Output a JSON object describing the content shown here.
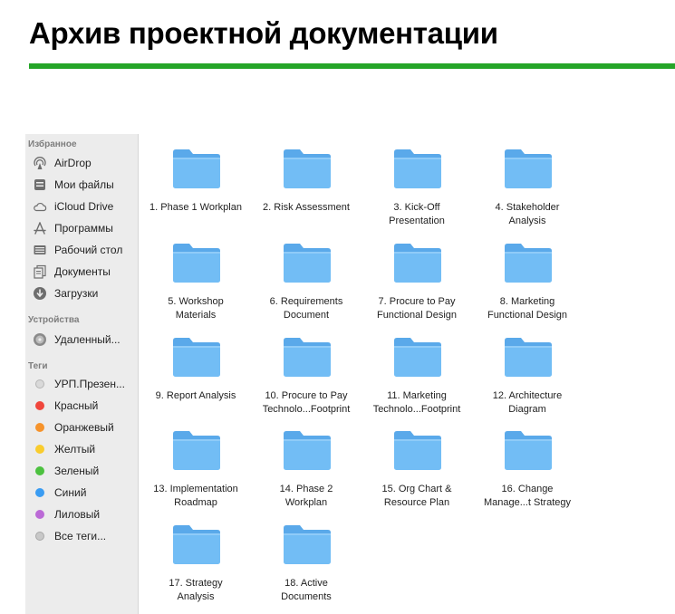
{
  "page_title": "Архив проектной документации",
  "colors": {
    "accent_rule": "#25a528",
    "folder": "#6fb9f3"
  },
  "sidebar": {
    "favorites_heading": "Избранное",
    "favorites": [
      {
        "label": "AirDrop",
        "icon": "airdrop-icon"
      },
      {
        "label": "Мои файлы",
        "icon": "my-files-icon"
      },
      {
        "label": "iCloud Drive",
        "icon": "cloud-icon"
      },
      {
        "label": "Программы",
        "icon": "applications-icon"
      },
      {
        "label": "Рабочий стол",
        "icon": "desktop-icon"
      },
      {
        "label": "Документы",
        "icon": "documents-icon"
      },
      {
        "label": "Загрузки",
        "icon": "downloads-icon"
      }
    ],
    "devices_heading": "Устройства",
    "devices": [
      {
        "label": "Удаленный...",
        "icon": "remote-disc-icon"
      }
    ],
    "tags_heading": "Теги",
    "tags": [
      {
        "label": "УРП.Презен...",
        "color": "#d9d9d9"
      },
      {
        "label": "Красный",
        "color": "#f0463c"
      },
      {
        "label": "Оранжевый",
        "color": "#f6932b"
      },
      {
        "label": "Желтый",
        "color": "#f9cc2d"
      },
      {
        "label": "Зеленый",
        "color": "#4cc13f"
      },
      {
        "label": "Синий",
        "color": "#3a9cf2"
      },
      {
        "label": "Лиловый",
        "color": "#bb6ad6"
      },
      {
        "label": "Все теги...",
        "color": "#c8c8c8"
      }
    ]
  },
  "folders": [
    {
      "line1": "1. Phase 1 Workplan",
      "line2": ""
    },
    {
      "line1": "2. Risk Assessment",
      "line2": ""
    },
    {
      "line1": "3. Kick-Off",
      "line2": "Presentation"
    },
    {
      "line1": "4. Stakeholder",
      "line2": "Analysis"
    },
    {
      "line1": "5. Workshop",
      "line2": "Materials"
    },
    {
      "line1": "6. Requirements",
      "line2": "Document"
    },
    {
      "line1": "7. Procure to Pay",
      "line2": "Functional Design"
    },
    {
      "line1": "8. Marketing",
      "line2": "Functional Design"
    },
    {
      "line1": "9. Report Analysis",
      "line2": ""
    },
    {
      "line1": "10. Procure to Pay",
      "line2": "Technolo...Footprint"
    },
    {
      "line1": "11. Marketing",
      "line2": "Technolo...Footprint"
    },
    {
      "line1": "12. Architecture",
      "line2": "Diagram"
    },
    {
      "line1": "13. Implementation",
      "line2": "Roadmap"
    },
    {
      "line1": "14. Phase 2",
      "line2": "Workplan"
    },
    {
      "line1": "15. Org Chart &",
      "line2": "Resource Plan"
    },
    {
      "line1": "16. Change",
      "line2": "Manage...t Strategy"
    },
    {
      "line1": "17. Strategy",
      "line2": "Analysis"
    },
    {
      "line1": "18. Active",
      "line2": "Documents"
    }
  ]
}
